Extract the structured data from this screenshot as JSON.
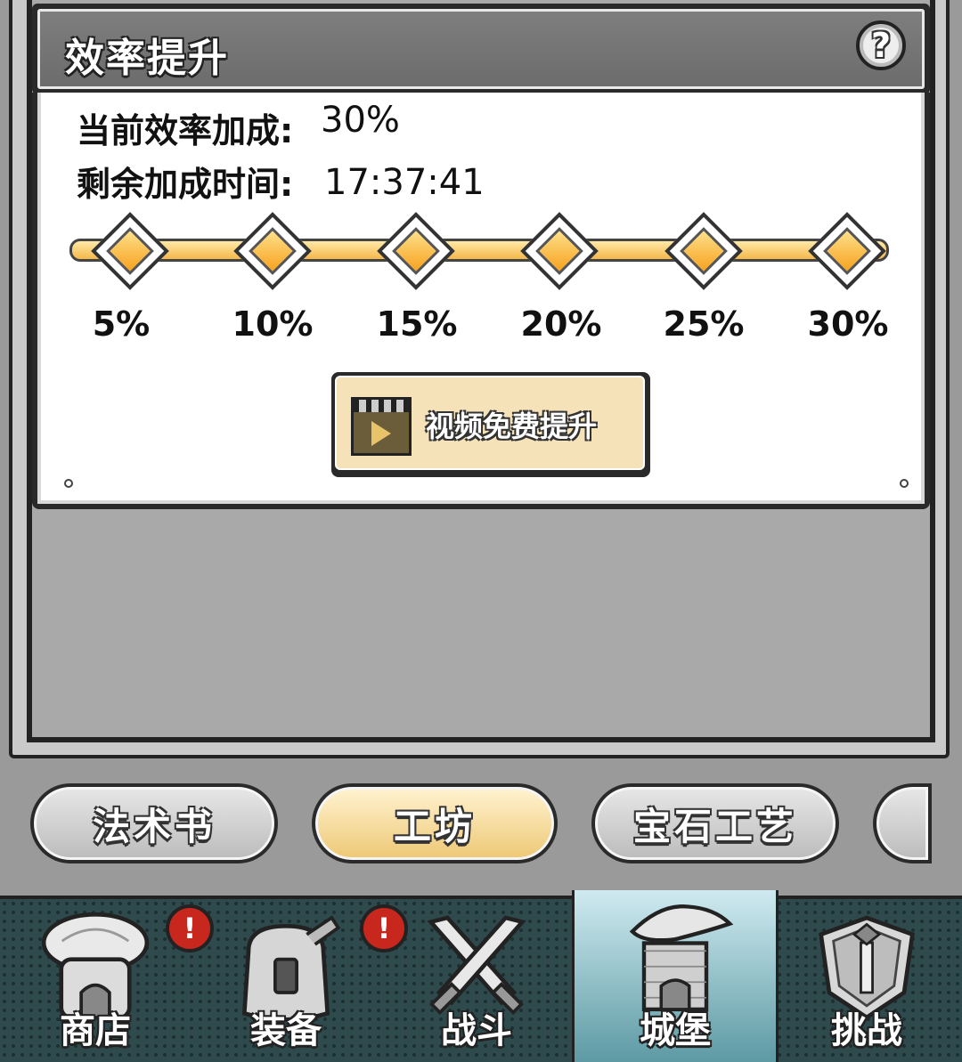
{
  "header": {
    "title": "效率提升",
    "help_label": "?"
  },
  "info": {
    "current_label": "当前效率加成:",
    "current_value": "30%",
    "remaining_label": "剩余加成时间:",
    "remaining_value": "17:37:41"
  },
  "milestones": [
    "5%",
    "10%",
    "15%",
    "20%",
    "25%",
    "30%"
  ],
  "video_button": {
    "label": "视频免费提升"
  },
  "tabs": [
    {
      "label": "法术书",
      "active": false
    },
    {
      "label": "工坊",
      "active": true
    },
    {
      "label": "宝石工艺",
      "active": false
    },
    {
      "label": "",
      "active": false
    }
  ],
  "nav": [
    {
      "label": "商店",
      "icon": "shop-icon",
      "alert": "!"
    },
    {
      "label": "装备",
      "icon": "backpack-icon",
      "alert": "!"
    },
    {
      "label": "战斗",
      "icon": "crossed-swords-icon"
    },
    {
      "label": "城堡",
      "icon": "castle-icon",
      "active": true
    },
    {
      "label": "挑战",
      "icon": "shield-icon"
    }
  ]
}
